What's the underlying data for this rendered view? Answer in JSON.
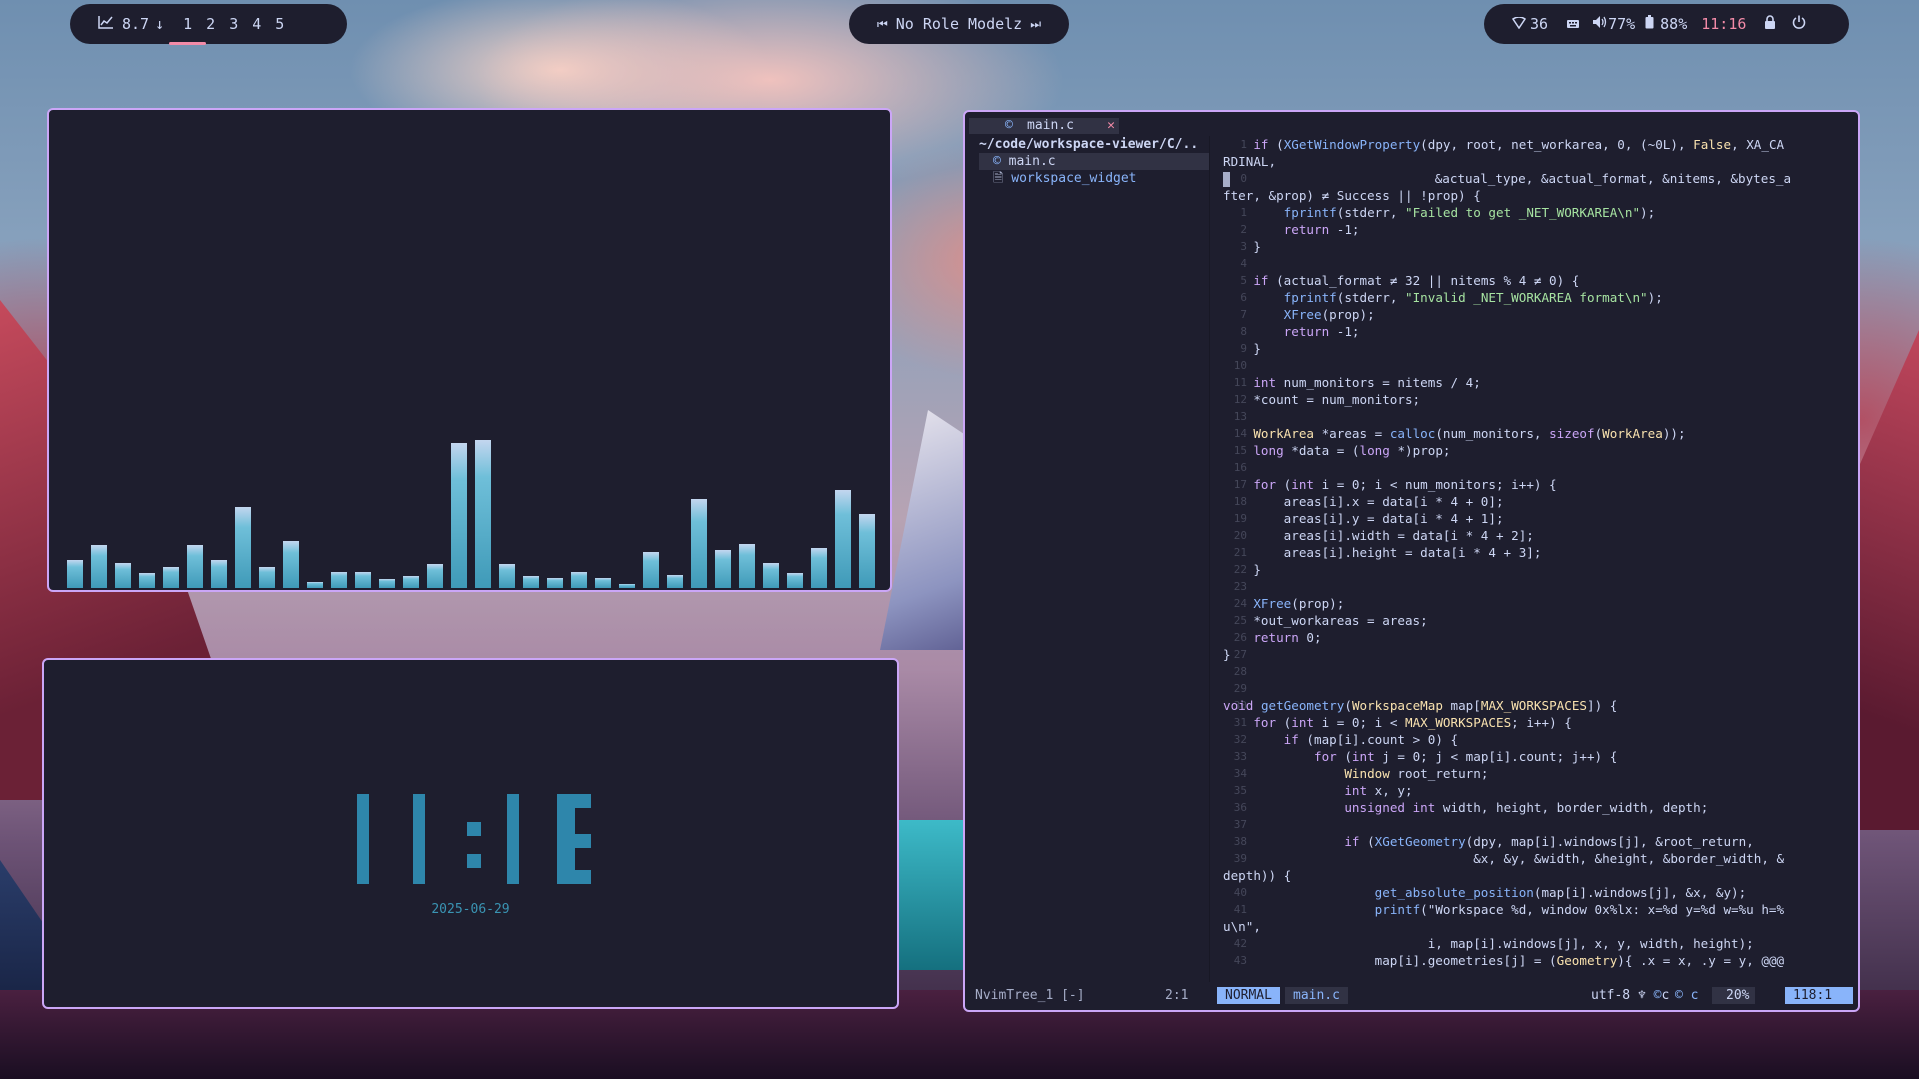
{
  "topbar": {
    "left": {
      "cpu_icon": "chart-line-icon",
      "cpu_value": "8.7",
      "arrow": "↓",
      "workspaces": [
        "1",
        "2",
        "3",
        "4",
        "5"
      ],
      "active_workspace": "1"
    },
    "center": {
      "prev_icon": "⏮",
      "title": "No Role Modelz",
      "next_icon": "⏭"
    },
    "right": {
      "wifi_value": "36",
      "volume_value": "77%",
      "battery_value": "88%",
      "time": "11:16"
    }
  },
  "visualizer": {
    "bar_values": [
      19,
      29,
      17,
      10,
      14,
      29,
      19,
      55,
      14,
      32,
      4,
      11,
      11,
      6,
      8,
      16,
      98,
      100,
      16,
      8,
      7,
      11,
      7,
      3,
      24,
      9,
      60,
      26,
      30,
      17,
      10,
      27,
      66,
      50
    ]
  },
  "clock": {
    "time": "11:16",
    "date": "2025-06-29"
  },
  "nvim": {
    "tab_label": "main.c",
    "tree": {
      "root": "~/code/workspace-viewer/C/..",
      "items": [
        "main.c",
        "workspace_widget"
      ]
    },
    "status": {
      "tree_label": "NvimTree_1 [-]",
      "tree_pos": "2:1",
      "mode": "NORMAL",
      "file": "main.c",
      "encoding": "utf-8",
      "filetype": "c",
      "percent": "20%",
      "position": "118:1"
    },
    "lines": [
      {
        "n": "1",
        "t": "    if (XGetWindowProperty(dpy, root, net_workarea, 0, (~0L), False, XA_CA"
      },
      {
        "n": "",
        "t": "RDINAL,"
      },
      {
        "n": "0",
        "t": "                           &actual_type, &actual_format, &nitems, &bytes_a",
        "cursor": true
      },
      {
        "n": "",
        "t": "fter, &prop) ≠ Success || !prop) {"
      },
      {
        "n": "1",
        "t": "        fprintf(stderr, \"Failed to get _NET_WORKAREA\\n\");"
      },
      {
        "n": "2",
        "t": "        return -1;"
      },
      {
        "n": "3",
        "t": "    }"
      },
      {
        "n": "4",
        "t": ""
      },
      {
        "n": "5",
        "t": "    if (actual_format ≠ 32 || nitems % 4 ≠ 0) {"
      },
      {
        "n": "6",
        "t": "        fprintf(stderr, \"Invalid _NET_WORKAREA format\\n\");"
      },
      {
        "n": "7",
        "t": "        XFree(prop);"
      },
      {
        "n": "8",
        "t": "        return -1;"
      },
      {
        "n": "9",
        "t": "    }"
      },
      {
        "n": "10",
        "t": ""
      },
      {
        "n": "11",
        "t": "    int num_monitors = nitems / 4;"
      },
      {
        "n": "12",
        "t": "    *count = num_monitors;"
      },
      {
        "n": "13",
        "t": ""
      },
      {
        "n": "14",
        "t": "    WorkArea *areas = calloc(num_monitors, sizeof(WorkArea));"
      },
      {
        "n": "15",
        "t": "    long *data = (long *)prop;"
      },
      {
        "n": "16",
        "t": ""
      },
      {
        "n": "17",
        "t": "    for (int i = 0; i < num_monitors; i++) {"
      },
      {
        "n": "18",
        "t": "        areas[i].x = data[i * 4 + 0];"
      },
      {
        "n": "19",
        "t": "        areas[i].y = data[i * 4 + 1];"
      },
      {
        "n": "20",
        "t": "        areas[i].width = data[i * 4 + 2];"
      },
      {
        "n": "21",
        "t": "        areas[i].height = data[i * 4 + 3];"
      },
      {
        "n": "22",
        "t": "    }"
      },
      {
        "n": "23",
        "t": ""
      },
      {
        "n": "24",
        "t": "    XFree(prop);"
      },
      {
        "n": "25",
        "t": "    *out_workareas = areas;"
      },
      {
        "n": "26",
        "t": "    return 0;"
      },
      {
        "n": "27",
        "t": "}"
      },
      {
        "n": "28",
        "t": ""
      },
      {
        "n": "29",
        "t": ""
      },
      {
        "n": "30",
        "t": "void getGeometry(WorkspaceMap map[MAX_WORKSPACES]) {"
      },
      {
        "n": "31",
        "t": "    for (int i = 0; i < MAX_WORKSPACES; i++) {"
      },
      {
        "n": "32",
        "t": "        if (map[i].count > 0) {"
      },
      {
        "n": "33",
        "t": "            for (int j = 0; j < map[i].count; j++) {"
      },
      {
        "n": "34",
        "t": "                Window root_return;"
      },
      {
        "n": "35",
        "t": "                int x, y;"
      },
      {
        "n": "36",
        "t": "                unsigned int width, height, border_width, depth;"
      },
      {
        "n": "37",
        "t": ""
      },
      {
        "n": "38",
        "t": "                if (XGetGeometry(dpy, map[i].windows[j], &root_return,"
      },
      {
        "n": "39",
        "t": "                                 &x, &y, &width, &height, &border_width, &"
      },
      {
        "n": "",
        "t": "depth)) {"
      },
      {
        "n": "40",
        "t": "                    get_absolute_position(map[i].windows[j], &x, &y);"
      },
      {
        "n": "41",
        "t": "                    printf(\"Workspace %d, window 0x%lx: x=%d y=%d w=%u h=%"
      },
      {
        "n": "",
        "t": "u\\n\","
      },
      {
        "n": "42",
        "t": "                           i, map[i].windows[j], x, y, width, height);"
      },
      {
        "n": "43",
        "t": "                    map[i].geometries[j] = (Geometry){ .x = x, .y = y, @@@"
      }
    ]
  }
}
